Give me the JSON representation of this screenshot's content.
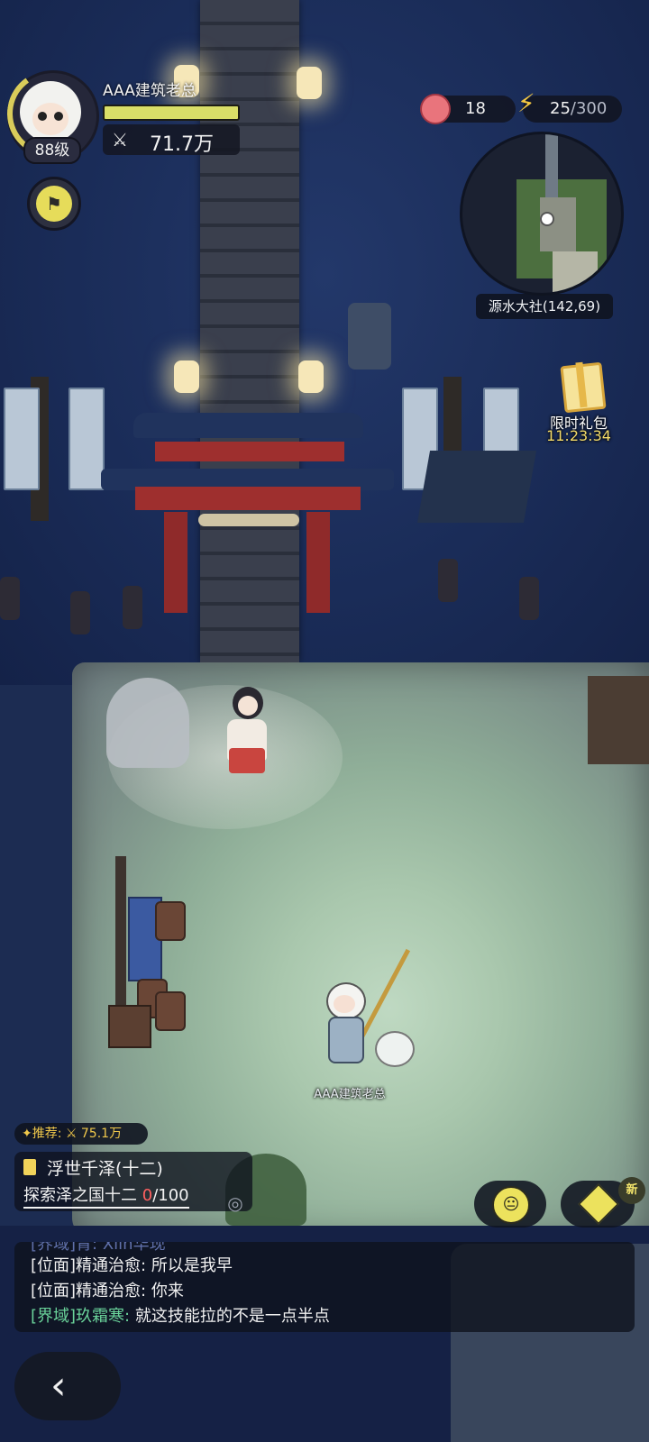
{
  "player": {
    "name": "AAA建筑老总",
    "level": "88级",
    "power": "71.7万",
    "power_icon": "crossed-swords-icon",
    "hp_fraction": 1.0,
    "world_name": "AAA建筑老总"
  },
  "resources": {
    "peach": "18",
    "stamina_current": "25",
    "stamina_max": "/300"
  },
  "minimap": {
    "location": "源水大社(142,69)"
  },
  "gift": {
    "label": "限时礼包",
    "timer": "11:23:34"
  },
  "quest": {
    "recommend": "✦推荐: ⚔ 75.1万",
    "title": "浮世千泽(十二)",
    "desc_prefix": "探索泽之国十二 ",
    "progress_current": "0",
    "progress_total": "/100"
  },
  "buttons": {
    "new_badge": "新",
    "back_icon": "‹"
  },
  "chat": {
    "lines": [
      {
        "channel": "[界域]",
        "speaker": "青: ",
        "text": "Xlih华现"
      },
      {
        "channel": "[位面]",
        "speaker": "精通治愈: ",
        "text": "所以是我早"
      },
      {
        "channel": "[位面]",
        "speaker": "精通治愈: ",
        "text": "你来"
      },
      {
        "channel": "[界域]",
        "speaker": "玖霜寒: ",
        "text": "就这技能拉的不是一点半点"
      }
    ]
  },
  "colors": {
    "accent_yellow": "#e6dc5a",
    "realm_green": "#6ad39a",
    "progress_red": "#ff6060",
    "timer_gold": "#f5dc6a"
  }
}
